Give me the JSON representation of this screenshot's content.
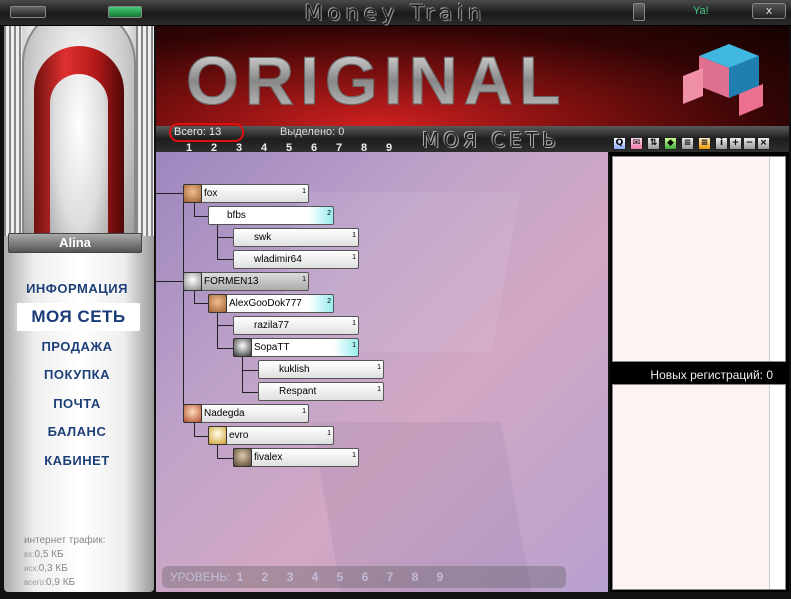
{
  "window": {
    "title": "Money Train",
    "yahoo_label": "Ya!",
    "close_label": "x"
  },
  "banner": {
    "title": "ORIGINAL"
  },
  "user": {
    "name": "Alina"
  },
  "nav": {
    "items": [
      {
        "label": "ИНФОРМАЦИЯ"
      },
      {
        "label": "МОЯ СЕТЬ"
      },
      {
        "label": "ПРОДАЖА"
      },
      {
        "label": "ПОКУПКА"
      },
      {
        "label": "ПОЧТА"
      },
      {
        "label": "БАЛАНС"
      },
      {
        "label": "КАБИНЕТ"
      }
    ],
    "active": "МОЯ СЕТЬ"
  },
  "traffic": {
    "title": "интернет трафик:",
    "in_label": "вх:",
    "in_value": "0,5 КБ",
    "out_label": "исх:",
    "out_value": "0,3 КБ",
    "total_label": "всего:",
    "total_value": "0,9 КБ"
  },
  "network": {
    "heading": "МОЯ СЕТЬ",
    "total": "Всего: 13",
    "selected": "Выделено: 0",
    "levels": [
      "1",
      "2",
      "3",
      "4",
      "5",
      "6",
      "7",
      "8",
      "9"
    ],
    "level_bar_label": "УРОВЕНЬ:",
    "tree": [
      {
        "name": "fox",
        "count": "1",
        "level": 1
      },
      {
        "name": "bfbs",
        "count": "2",
        "level": 2
      },
      {
        "name": "swk",
        "count": "1",
        "level": 3
      },
      {
        "name": "wladimir64",
        "count": "1",
        "level": 3
      },
      {
        "name": "FORMEN13",
        "count": "1",
        "level": 1
      },
      {
        "name": "AlexGooDok777",
        "count": "2",
        "level": 2
      },
      {
        "name": "razila77",
        "count": "1",
        "level": 3
      },
      {
        "name": "SopaTT",
        "count": "1",
        "level": 3
      },
      {
        "name": "kuklish",
        "count": "1",
        "level": 4
      },
      {
        "name": "Respant",
        "count": "1",
        "level": 4
      },
      {
        "name": "Nadegda",
        "count": "1",
        "level": 1
      },
      {
        "name": "evro",
        "count": "1",
        "level": 2
      },
      {
        "name": "fivalex",
        "count": "1",
        "level": 3
      }
    ]
  },
  "toolbar_icons": [
    "search-icon",
    "mail-icon",
    "sort-icon",
    "shield-icon",
    "list-icon",
    "list-alt-icon",
    "info-icon",
    "plus-icon",
    "minus-icon",
    "close-icon"
  ],
  "registrations": {
    "label": "Новых регистраций: 0"
  }
}
